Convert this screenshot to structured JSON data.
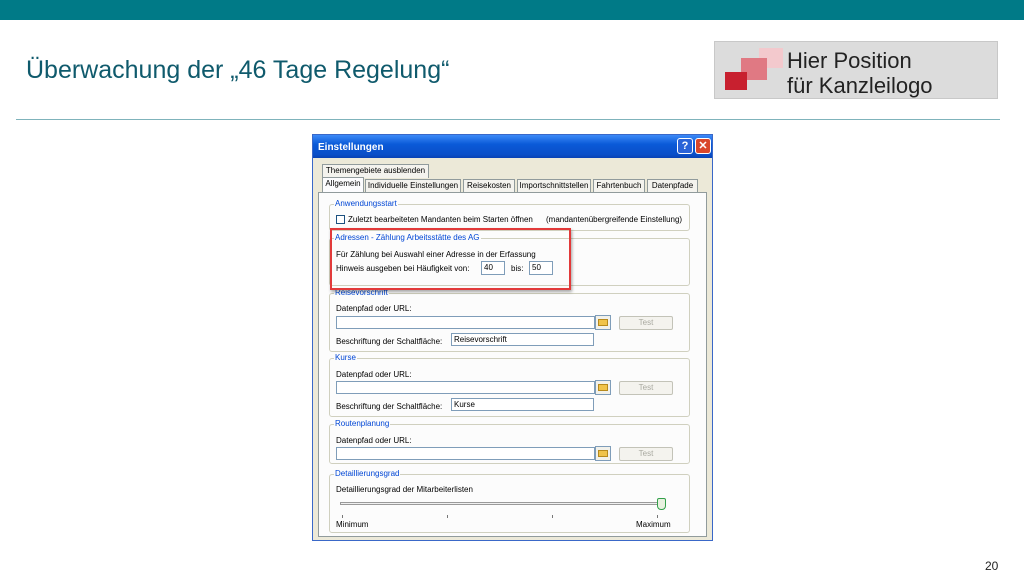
{
  "slide": {
    "title": "Überwachung der „46 Tage Regelung“",
    "logo_line1": "Hier Position",
    "logo_line2": "für Kanzleilogo",
    "page_number": "20"
  },
  "window": {
    "title": "Einstellungen",
    "help_glyph": "?",
    "close_glyph": "✕"
  },
  "tabs": {
    "row1": "Themengebiete ausblenden",
    "allgemein": "Allgemein",
    "individuelle": "Individuelle Einstellungen",
    "reisekosten": "Reisekosten",
    "importschnittstellen": "Importschnittstellen",
    "fahrtenbuch": "Fahrtenbuch",
    "datenpfade": "Datenpfade"
  },
  "anwendungsstart": {
    "label": "Anwendungsstart",
    "checkbox_label": "Zuletzt bearbeiteten Mandanten beim Starten öffnen",
    "note": "(mandantenübergreifende Einstellung)",
    "checked": false
  },
  "adressen": {
    "label": "Adressen - Zählung Arbeitsstätte des AG",
    "line1": "Für Zählung bei Auswahl einer Adresse in der Erfassung",
    "line2": "Hinweis ausgeben bei Häufigkeit von:",
    "from_value": "40",
    "to_label": "bis:",
    "to_value": "50"
  },
  "reisevorschrift": {
    "label": "Reisevorschrift",
    "path_label": "Datenpfad oder URL:",
    "path_value": "",
    "test_label": "Test",
    "caption_label": "Beschriftung der Schaltfläche:",
    "caption_value": "Reisevorschrift"
  },
  "kurse": {
    "label": "Kurse",
    "path_label": "Datenpfad oder URL:",
    "path_value": "",
    "test_label": "Test",
    "caption_label": "Beschriftung der Schaltfläche:",
    "caption_value": "Kurse"
  },
  "routenplanung": {
    "label": "Routenplanung",
    "path_label": "Datenpfad oder URL:",
    "path_value": "",
    "test_label": "Test"
  },
  "detaillierungsgrad": {
    "label": "Detaillierungsgrad",
    "description": "Detaillierungsgrad der Mitarbeiterlisten",
    "min_label": "Minimum",
    "max_label": "Maximum",
    "level": 1.0
  },
  "colors": {
    "accent_bar": "#007a87",
    "title_text": "#0f5a6c",
    "highlight_box": "#e23a3a",
    "group_label": "#0046d5"
  },
  "icons": [
    "help-icon",
    "close-icon",
    "folder-icon"
  ]
}
